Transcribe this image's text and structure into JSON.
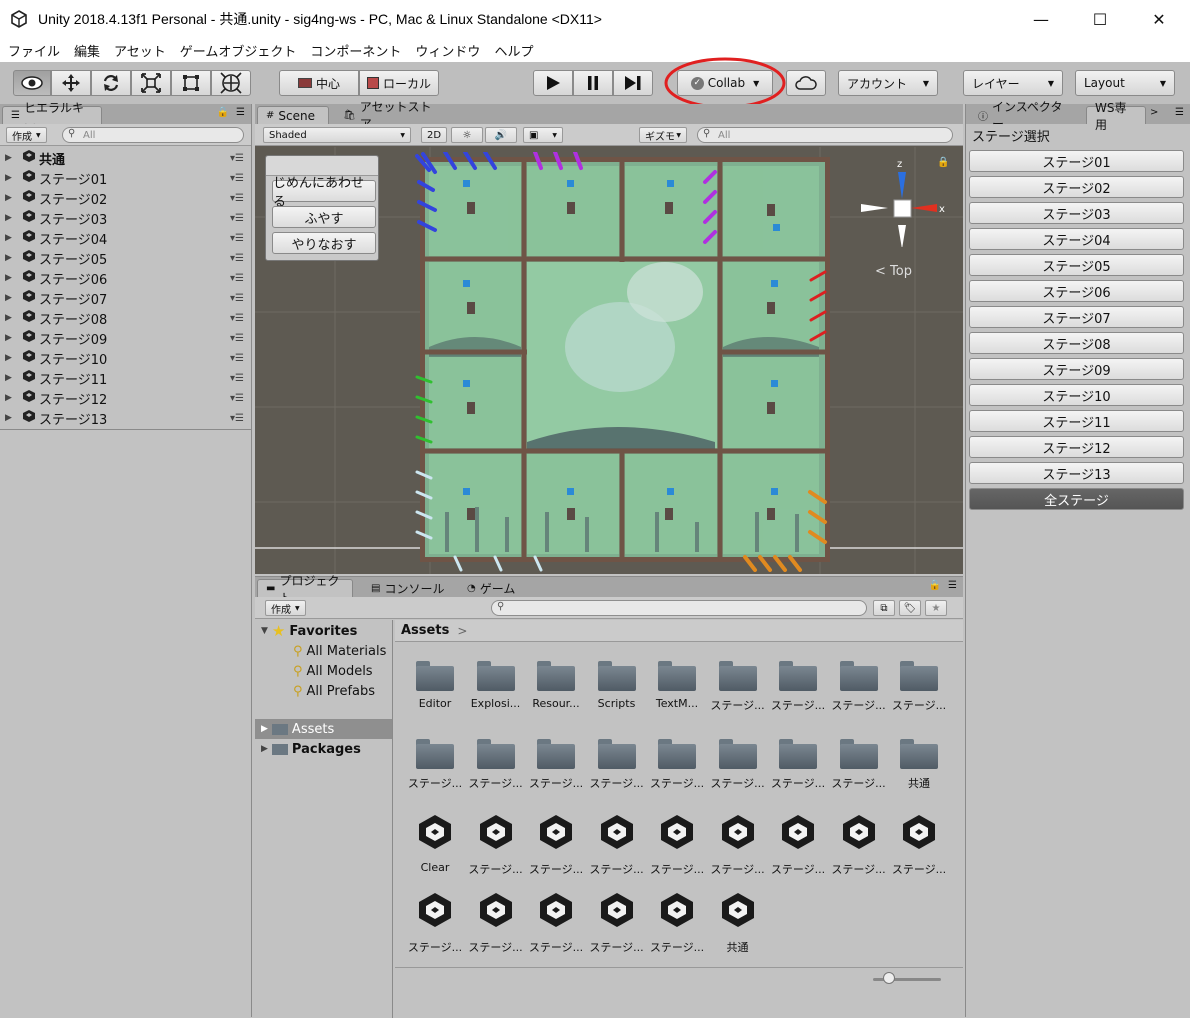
{
  "window": {
    "title": "Unity 2018.4.13f1 Personal - 共通.unity - sig4ng-ws - PC, Mac & Linux Standalone <DX11>",
    "controls": [
      "—",
      "☐",
      "✕"
    ]
  },
  "menu": [
    "ファイル",
    "編集",
    "アセット",
    "ゲームオブジェクト",
    "コンポーネント",
    "ウィンドウ",
    "ヘルプ"
  ],
  "toolbar": {
    "pivot": "中心",
    "space": "ローカル",
    "collab": "Collab",
    "account": "アカウント",
    "layers": "レイヤー",
    "layout": "Layout",
    "highlight_color": "#e02020"
  },
  "hierarchy": {
    "tab": "ヒエラルキー",
    "create": "作成",
    "search_placeholder": "All",
    "items": [
      "共通",
      "ステージ01",
      "ステージ02",
      "ステージ03",
      "ステージ04",
      "ステージ05",
      "ステージ06",
      "ステージ07",
      "ステージ08",
      "ステージ09",
      "ステージ10",
      "ステージ11",
      "ステージ12",
      "ステージ13"
    ]
  },
  "scene": {
    "tabs": [
      "Scene",
      "アセットストア"
    ],
    "shading": "Shaded",
    "mode_2d": "2D",
    "gizmos": "ギズモ",
    "search_placeholder": "All",
    "overlay_buttons": [
      "じめんにあわせる",
      "ふやす",
      "やりなおす"
    ],
    "gizmo_axes": {
      "z": "z",
      "x": "x"
    },
    "view_label": "Top"
  },
  "inspector": {
    "tabs": [
      "インスペクター",
      "WS専用"
    ],
    "header": "ステージ選択",
    "buttons": [
      "ステージ01",
      "ステージ02",
      "ステージ03",
      "ステージ04",
      "ステージ05",
      "ステージ06",
      "ステージ07",
      "ステージ08",
      "ステージ09",
      "ステージ10",
      "ステージ11",
      "ステージ12",
      "ステージ13"
    ],
    "all_button": "全ステージ"
  },
  "project": {
    "tabs": [
      "プロジェクト",
      "コンソール",
      "ゲーム"
    ],
    "create": "作成",
    "favorites": "Favorites",
    "favorite_items": [
      "All Materials",
      "All Models",
      "All Prefabs"
    ],
    "roots": [
      "Assets",
      "Packages"
    ],
    "breadcrumb": "Assets",
    "assets": [
      {
        "name": "Editor",
        "kind": "folder"
      },
      {
        "name": "Explosi...",
        "kind": "folder"
      },
      {
        "name": "Resour...",
        "kind": "folder"
      },
      {
        "name": "Scripts",
        "kind": "folder"
      },
      {
        "name": "TextM...",
        "kind": "folder"
      },
      {
        "name": "ステージ...",
        "kind": "folder"
      },
      {
        "name": "ステージ...",
        "kind": "folder"
      },
      {
        "name": "ステージ...",
        "kind": "folder"
      },
      {
        "name": "ステージ...",
        "kind": "folder"
      },
      {
        "name": "ステージ...",
        "kind": "folder"
      },
      {
        "name": "ステージ...",
        "kind": "folder"
      },
      {
        "name": "ステージ...",
        "kind": "folder"
      },
      {
        "name": "ステージ...",
        "kind": "folder"
      },
      {
        "name": "ステージ...",
        "kind": "folder"
      },
      {
        "name": "ステージ...",
        "kind": "folder"
      },
      {
        "name": "ステージ...",
        "kind": "folder"
      },
      {
        "name": "ステージ...",
        "kind": "folder"
      },
      {
        "name": "共通",
        "kind": "folder"
      },
      {
        "name": "Clear",
        "kind": "scene"
      },
      {
        "name": "ステージ...",
        "kind": "scene"
      },
      {
        "name": "ステージ...",
        "kind": "scene"
      },
      {
        "name": "ステージ...",
        "kind": "scene"
      },
      {
        "name": "ステージ...",
        "kind": "scene"
      },
      {
        "name": "ステージ...",
        "kind": "scene"
      },
      {
        "name": "ステージ...",
        "kind": "scene"
      },
      {
        "name": "ステージ...",
        "kind": "scene"
      },
      {
        "name": "ステージ...",
        "kind": "scene"
      },
      {
        "name": "ステージ...",
        "kind": "scene"
      },
      {
        "name": "ステージ...",
        "kind": "scene"
      },
      {
        "name": "ステージ...",
        "kind": "scene"
      },
      {
        "name": "ステージ...",
        "kind": "scene"
      },
      {
        "name": "ステージ...",
        "kind": "scene"
      },
      {
        "name": "共通",
        "kind": "scene"
      }
    ]
  }
}
